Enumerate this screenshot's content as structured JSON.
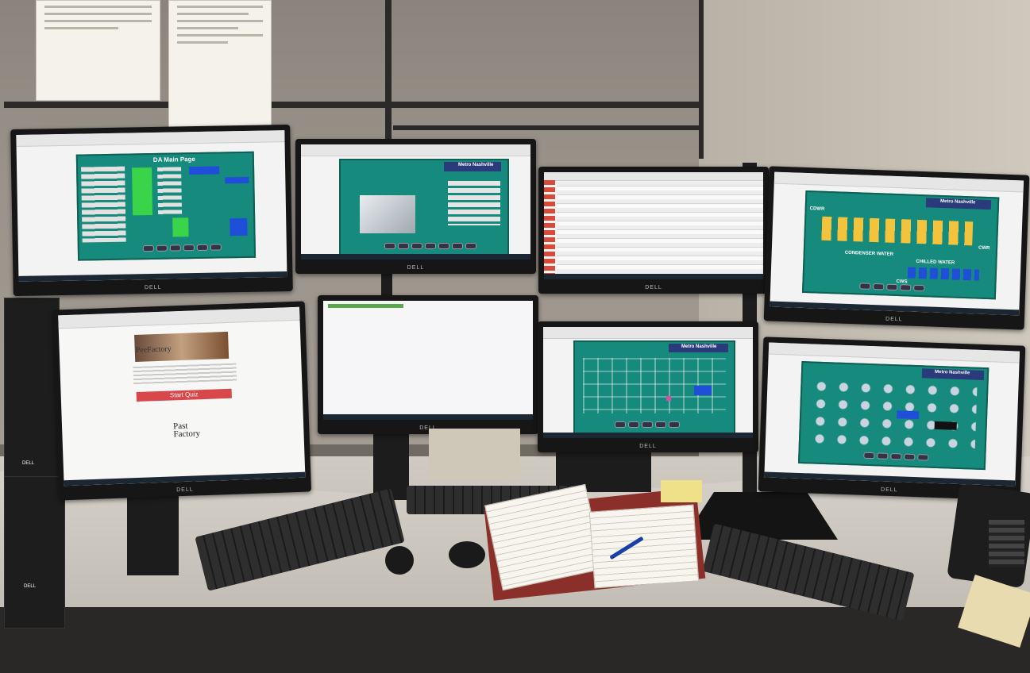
{
  "scene": {
    "monitor_brand": "DELL",
    "tower_brand": "DELL"
  },
  "screens": {
    "top_left": {
      "title": "DA Main Page"
    },
    "top_middle": {
      "title": "Metro Nashville"
    },
    "top_right": {
      "title": "Metro Nashville",
      "labels": [
        "CDWR",
        "CWR",
        "CONDENSER WATER",
        "CHILLED WATER",
        "CWS"
      ]
    },
    "bottom_left": {
      "brand": "PeeFactory",
      "button": "Start Quiz",
      "footer": "Past Factory"
    },
    "bottom_right_a": {
      "title": "Metro Nashville"
    },
    "bottom_right_b": {
      "title": "Metro Nashville"
    }
  },
  "colors": {
    "scada_teal": "#168a7c",
    "quiz_red": "#d8474a"
  }
}
